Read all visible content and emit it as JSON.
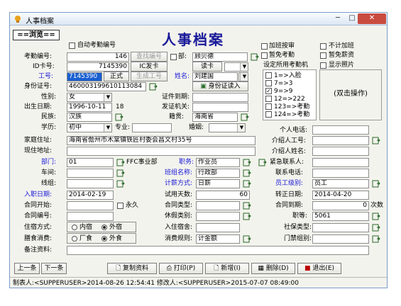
{
  "window": {
    "title": "人事档案",
    "close": "✕",
    "min": "─",
    "max": "□"
  },
  "browse_label": "==浏览==",
  "big_title": "人事档案",
  "auto_number_label": "自动考勤编号",
  "top_checks": {
    "overtime_limit": "加班按审",
    "no_overtime": "不计加班",
    "exempt_attend": "暂免考勤",
    "exempt_salary": "暂免薪资",
    "show_photo": "显示照片"
  },
  "set_machine_label": "设定所用考勤机",
  "double_click": "(双击操作)",
  "machines": [
    {
      "label": "1=>入脸",
      "checked": false
    },
    {
      "label": "7=>3",
      "checked": false
    },
    {
      "label": "9=>9",
      "checked": true
    },
    {
      "label": "12=>222",
      "checked": false
    },
    {
      "label": "123=>考勤",
      "checked": false
    },
    {
      "label": "124=>考勤",
      "checked": false
    }
  ],
  "fields": {
    "att_no": {
      "label": "考勤编号:",
      "value": "146"
    },
    "query_no": "查找编号",
    "dept_chk": "部:",
    "dept_val": "顾贝德",
    "id_card": {
      "label": "ID卡号:",
      "value": "7145390"
    },
    "ic_card": "IC发卡",
    "read_card": "读卡",
    "emp_no": {
      "label": "工号:",
      "value": "7145390"
    },
    "formal": "正式",
    "gen_emp_no": "生成工号",
    "name": {
      "label": "姓名:",
      "value": "刘建国"
    },
    "id_no": {
      "label": "身份证号:",
      "value": "460003199610113084"
    },
    "id_read": "身份证读入",
    "gender": {
      "label": "性别:",
      "value": "女"
    },
    "cert_expire": "证件到期:",
    "birth": {
      "label": "出生日期:",
      "value": "1996-10-11",
      "age": "18"
    },
    "issuer": "发证机关:",
    "nation": {
      "label": "民族:",
      "value": "汉族"
    },
    "native": {
      "label": "籍贯:",
      "value": "海南省"
    },
    "education": {
      "label": "学历:",
      "value": "初中"
    },
    "major": "专业:",
    "marital": "婚姻:",
    "personal_phone": "个人电话:",
    "home_addr": {
      "label": "家庭住址:",
      "value": "海南省儋州市木棠镇铁匠村委会昌文村35号"
    },
    "referrer_no": "介绍人工号:",
    "current_addr": "现住地址:",
    "referrer_name": "介绍人姓名:",
    "department": {
      "label": "部门:",
      "value": "01",
      "text": "FFC事业部"
    },
    "position": {
      "label": "职务:",
      "value": "作业员"
    },
    "emergency": "紧急联系人:",
    "workshop": "车间:",
    "shift": {
      "label": "班组名称:",
      "value": "行政部"
    },
    "contact_phone": "联系电话:",
    "line": "线组:",
    "pay_method": {
      "label": "计薪方式:",
      "value": "日薪"
    },
    "staff_level": {
      "label": "员工级别:",
      "value": "员工"
    },
    "entry_date": {
      "label": "入职日期:",
      "value": "2014-02-19"
    },
    "probation": {
      "label": "试用天数:",
      "value": "60"
    },
    "regular_date": {
      "label": "转正日期:",
      "value": "2014-04-20"
    },
    "contract_start": "合同开始:",
    "permanent": "永久",
    "contract_type": "合同类型:",
    "contract_term": {
      "label": "合同到期:",
      "value": "0",
      "unit": "次数"
    },
    "contract_no": "合同编号:",
    "leave_type": "休假类别:",
    "title_no": {
      "label": "职等:",
      "value": "5061"
    },
    "housing": {
      "label": "住宿方式:",
      "opt1": "内宿",
      "opt2": "外宿"
    },
    "dorm": "入住宿舍:",
    "social": "社保类型:",
    "meals": {
      "label": "膳食消费:",
      "opt1": "厂食",
      "opt2": "外食"
    },
    "consume_rule": {
      "label": "消费规则:",
      "value": "计金额"
    },
    "door_group": "门禁组别:",
    "remarks": "备注资料:"
  },
  "nav": {
    "prev": "上一条",
    "next": "下一条"
  },
  "actions": {
    "copy": "复制资料",
    "print": "打印(P)",
    "add": "新增(I)",
    "delete": "删除(D)",
    "exit": "退出(E)"
  },
  "status": "制表人:<SUPPERUSER>2014-08-26 12:54:41  修改人:<SUPPERUSER>2015-07-07 08:49:00"
}
